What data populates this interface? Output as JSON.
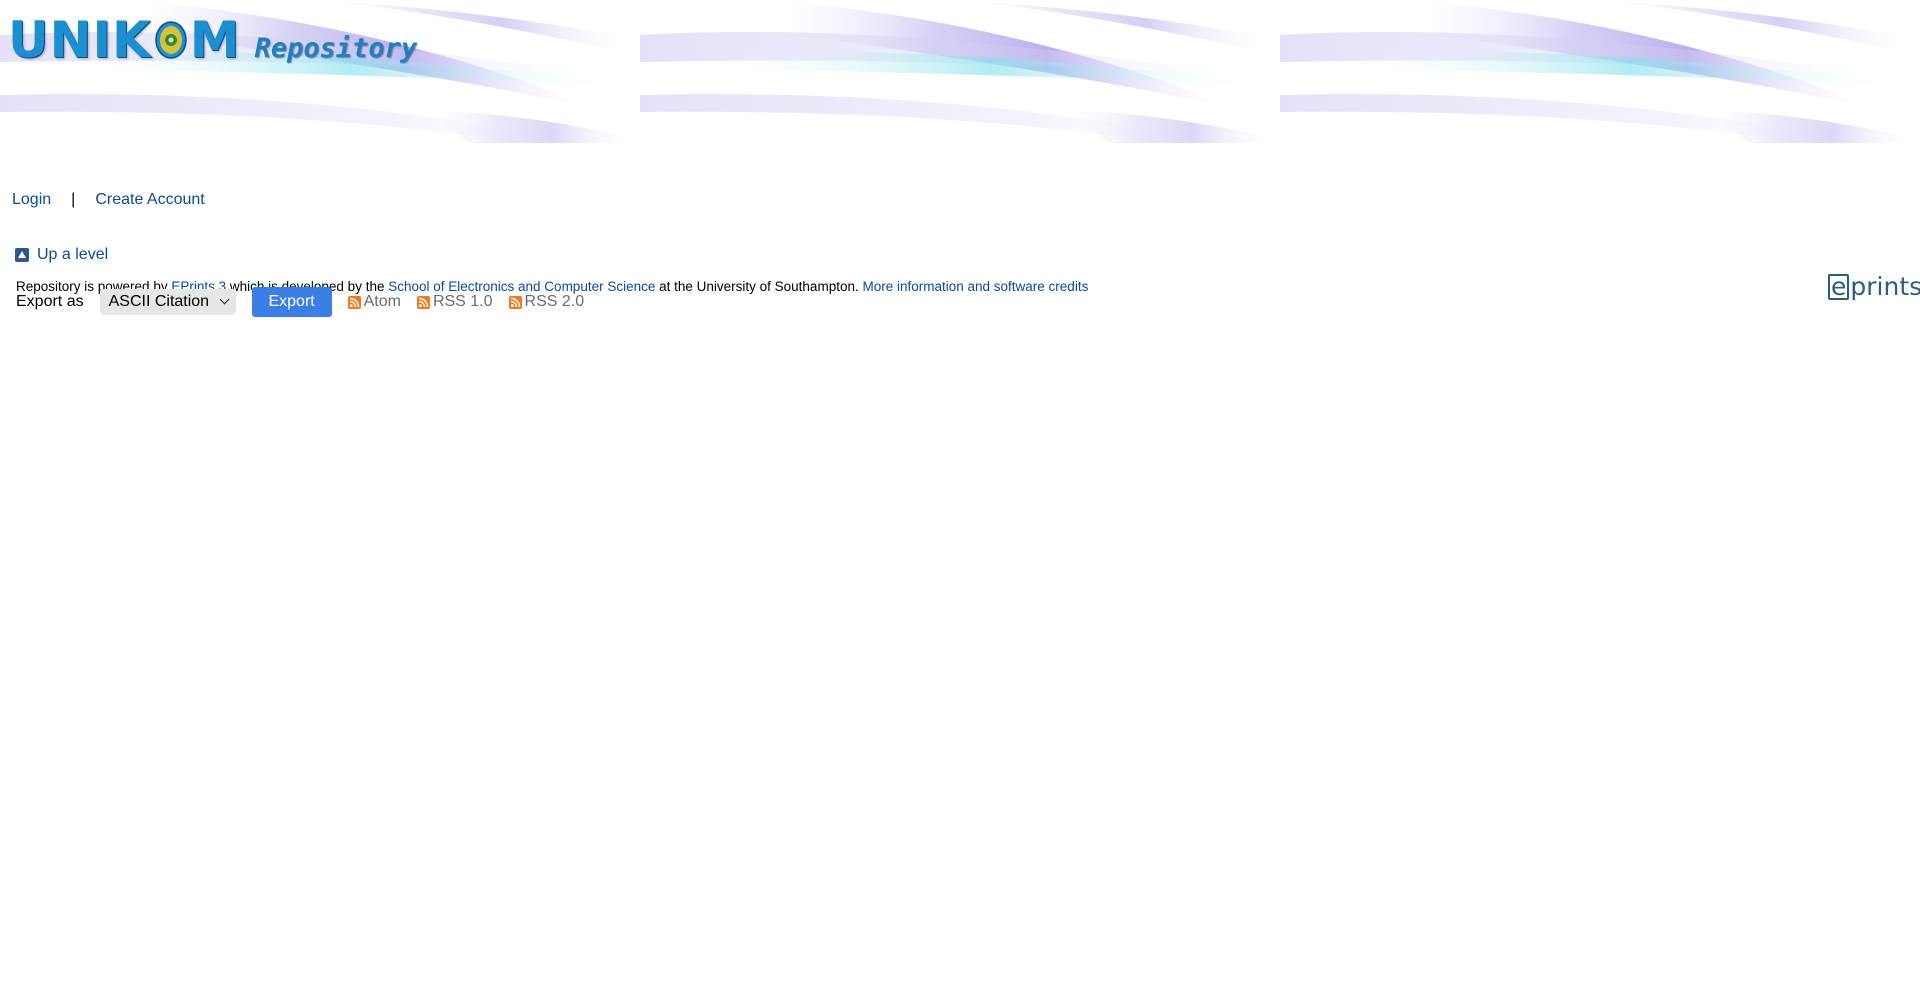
{
  "header": {
    "logo_main_left": "UNIK",
    "logo_main_right": "M",
    "logo_sub": "Repository"
  },
  "loginbar": {
    "login_label": "Login",
    "separator": "|",
    "create_account_label": "Create Account"
  },
  "navigation": {
    "up_a_level_label": "Up a level"
  },
  "export": {
    "label": "Export as",
    "selected_format": "ASCII Citation",
    "button_label": "Export",
    "feeds": [
      {
        "label": "Atom",
        "icon": "rss-icon"
      },
      {
        "label": "RSS 1.0",
        "icon": "rss-icon"
      },
      {
        "label": "RSS 2.0",
        "icon": "rss-icon"
      }
    ]
  },
  "footer": {
    "text_1": "Repository is powered by ",
    "link_eprints": "EPrints 3",
    "text_2": " which is developed by the ",
    "link_ecs": "School of Electronics and Computer Science",
    "text_3": " at the University of Southampton. ",
    "link_credits": "More information and software credits",
    "eprints_logo_e": "e",
    "eprints_logo_rest": "prints"
  },
  "colors": {
    "link": "#0b4a9e",
    "button": "#3b7fe6",
    "banner_wave": "#9b8fe6",
    "banner_accent": "#7fe0ec",
    "eprints_logo": "#2c5f7e",
    "rss": "#f07a1e"
  }
}
